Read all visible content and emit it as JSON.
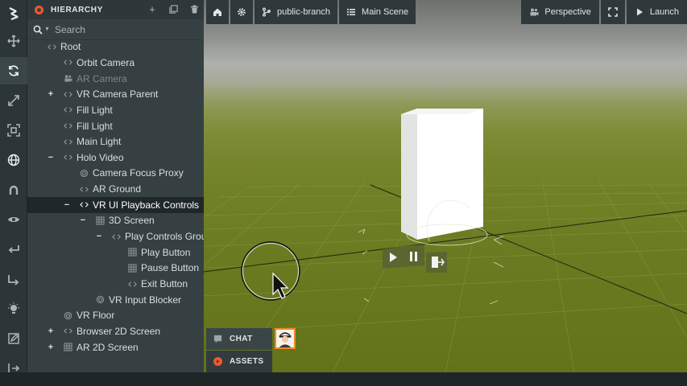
{
  "toolbar": {
    "items": [
      {
        "name": "logo-icon"
      },
      {
        "name": "move-icon"
      },
      {
        "name": "rotate-icon",
        "active": true
      },
      {
        "name": "scale-icon"
      },
      {
        "name": "resize-icon"
      },
      {
        "name": "globe-icon"
      },
      {
        "name": "magnet-icon"
      },
      {
        "name": "eye-icon"
      },
      {
        "name": "import-icon"
      },
      {
        "name": "export-icon"
      },
      {
        "name": "light-icon"
      },
      {
        "name": "edit-icon"
      },
      {
        "name": "publish-icon"
      }
    ]
  },
  "hierarchy": {
    "title": "HIERARCHY",
    "search_placeholder": "Search",
    "items": [
      {
        "label": "Root",
        "depth": 0,
        "icon": "code-icon",
        "expander": ""
      },
      {
        "label": "Orbit Camera",
        "depth": 1,
        "icon": "code-icon",
        "expander": ""
      },
      {
        "label": "AR Camera",
        "depth": 1,
        "icon": "camera-icon",
        "expander": "",
        "dim": true
      },
      {
        "label": "VR Camera Parent",
        "depth": 1,
        "icon": "code-icon",
        "expander": "+"
      },
      {
        "label": "Fill Light",
        "depth": 1,
        "icon": "code-icon",
        "expander": ""
      },
      {
        "label": "Fill Light",
        "depth": 1,
        "icon": "code-icon",
        "expander": ""
      },
      {
        "label": "Main Light",
        "depth": 1,
        "icon": "code-icon",
        "expander": ""
      },
      {
        "label": "Holo Video",
        "depth": 1,
        "icon": "code-icon",
        "expander": "−"
      },
      {
        "label": "Camera Focus Proxy",
        "depth": 2,
        "icon": "sphere-icon",
        "expander": ""
      },
      {
        "label": "AR Ground",
        "depth": 2,
        "icon": "code-icon",
        "expander": ""
      },
      {
        "label": "VR UI Playback Controls",
        "depth": 2,
        "icon": "code-icon",
        "expander": "−",
        "selected": true
      },
      {
        "label": "3D Screen",
        "depth": 3,
        "icon": "grid-icon",
        "expander": "−"
      },
      {
        "label": "Play Controls Group",
        "depth": 4,
        "icon": "code-icon",
        "expander": "−"
      },
      {
        "label": "Play Button",
        "depth": 5,
        "icon": "grid-icon",
        "expander": ""
      },
      {
        "label": "Pause Button",
        "depth": 5,
        "icon": "grid-icon",
        "expander": ""
      },
      {
        "label": "Exit Button",
        "depth": 5,
        "icon": "code-icon",
        "expander": ""
      },
      {
        "label": "VR Input Blocker",
        "depth": 3,
        "icon": "sphere-icon",
        "expander": ""
      },
      {
        "label": "VR Floor",
        "depth": 1,
        "icon": "sphere-icon",
        "expander": ""
      },
      {
        "label": "Browser 2D Screen",
        "depth": 1,
        "icon": "code-icon",
        "expander": "+"
      },
      {
        "label": "AR 2D Screen",
        "depth": 1,
        "icon": "grid-icon",
        "expander": "+"
      }
    ]
  },
  "viewport_bar": {
    "branch": "public-branch",
    "scene": "Main Scene",
    "perspective": "Perspective",
    "launch": "Launch"
  },
  "dock": {
    "chat": "CHAT",
    "assets": "ASSETS"
  },
  "colors": {
    "accent": "#f0582c",
    "panel": "#364043",
    "selected_row": "#1f2729",
    "ground": "#6f7f24"
  }
}
